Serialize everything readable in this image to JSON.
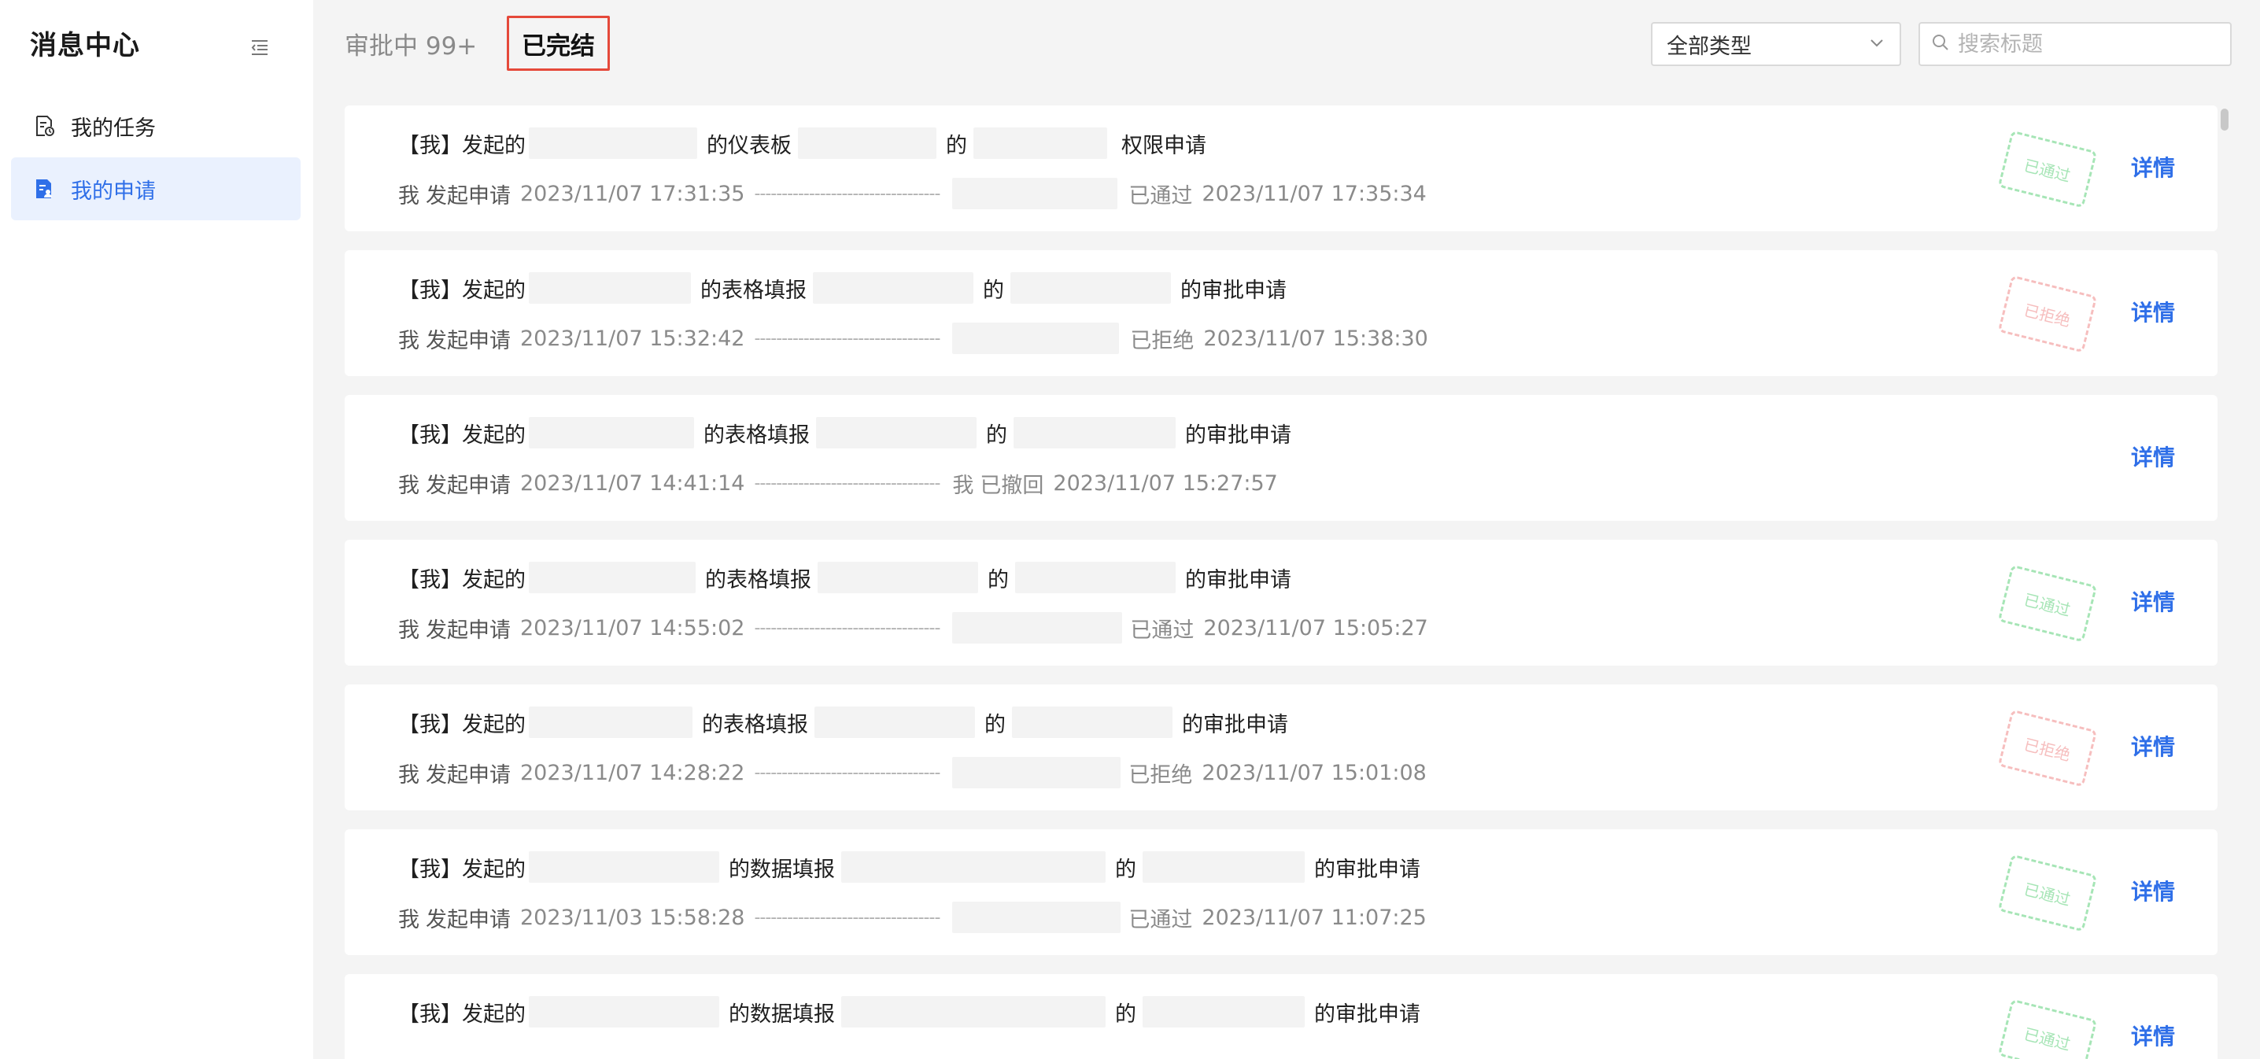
{
  "sidebar": {
    "title": "消息中心",
    "items": [
      {
        "label": "我的任务",
        "icon": "task-document-icon",
        "active": false
      },
      {
        "label": "我的申请",
        "icon": "application-document-icon",
        "active": true
      }
    ]
  },
  "tabs": {
    "pending": "审批中 99+",
    "done": "已完结"
  },
  "filter": {
    "type_selected": "全部类型",
    "search_placeholder": "搜索标题"
  },
  "colors": {
    "accent": "#2f6fe8",
    "approved": "#5fd07b",
    "rejected": "#f08a8a",
    "highlight_border": "#e5493a"
  },
  "labels": {
    "detail": "详情"
  },
  "records": [
    {
      "prefix": "【我】发起的",
      "object_type": "的仪表板",
      "joiner": "的",
      "suffix": "权限申请",
      "applicant": "我",
      "apply_action": "发起申请",
      "apply_time": "2023/11/07 17:31:35",
      "result_actor": "",
      "result": "已通过",
      "result_time": "2023/11/07 17:35:34",
      "stamp": "已通过",
      "stamp_kind": "approved"
    },
    {
      "prefix": "【我】发起的",
      "object_type": "的表格填报",
      "joiner": "的",
      "suffix": "的审批申请",
      "applicant": "我",
      "apply_action": "发起申请",
      "apply_time": "2023/11/07 15:32:42",
      "result_actor": "",
      "result": "已拒绝",
      "result_time": "2023/11/07 15:38:30",
      "stamp": "已拒绝",
      "stamp_kind": "rejected"
    },
    {
      "prefix": "【我】发起的",
      "object_type": "的表格填报",
      "joiner": "的",
      "suffix": "的审批申请",
      "applicant": "我",
      "apply_action": "发起申请",
      "apply_time": "2023/11/07 14:41:14",
      "result_actor": "我",
      "result": "已撤回",
      "result_time": "2023/11/07 15:27:57",
      "stamp": "",
      "stamp_kind": "none"
    },
    {
      "prefix": "【我】发起的",
      "object_type": "的表格填报",
      "joiner": "的",
      "suffix": "的审批申请",
      "applicant": "我",
      "apply_action": "发起申请",
      "apply_time": "2023/11/07 14:55:02",
      "result_actor": "",
      "result": "已通过",
      "result_time": "2023/11/07 15:05:27",
      "stamp": "已通过",
      "stamp_kind": "approved"
    },
    {
      "prefix": "【我】发起的",
      "object_type": "的表格填报",
      "joiner": "的",
      "suffix": "的审批申请",
      "applicant": "我",
      "apply_action": "发起申请",
      "apply_time": "2023/11/07 14:28:22",
      "result_actor": "",
      "result": "已拒绝",
      "result_time": "2023/11/07 15:01:08",
      "stamp": "已拒绝",
      "stamp_kind": "rejected"
    },
    {
      "prefix": "【我】发起的",
      "object_type": "的数据填报",
      "joiner": "的",
      "suffix": "的审批申请",
      "applicant": "我",
      "apply_action": "发起申请",
      "apply_time": "2023/11/03 15:58:28",
      "result_actor": "",
      "result": "已通过",
      "result_time": "2023/11/07 11:07:25",
      "stamp": "已通过",
      "stamp_kind": "approved"
    },
    {
      "prefix": "【我】发起的",
      "object_type": "的数据填报",
      "joiner": "的",
      "suffix": "的审批申请",
      "applicant": "",
      "apply_action": "",
      "apply_time": "",
      "result_actor": "",
      "result": "",
      "result_time": "",
      "stamp": "已通过",
      "stamp_kind": "approved"
    }
  ]
}
